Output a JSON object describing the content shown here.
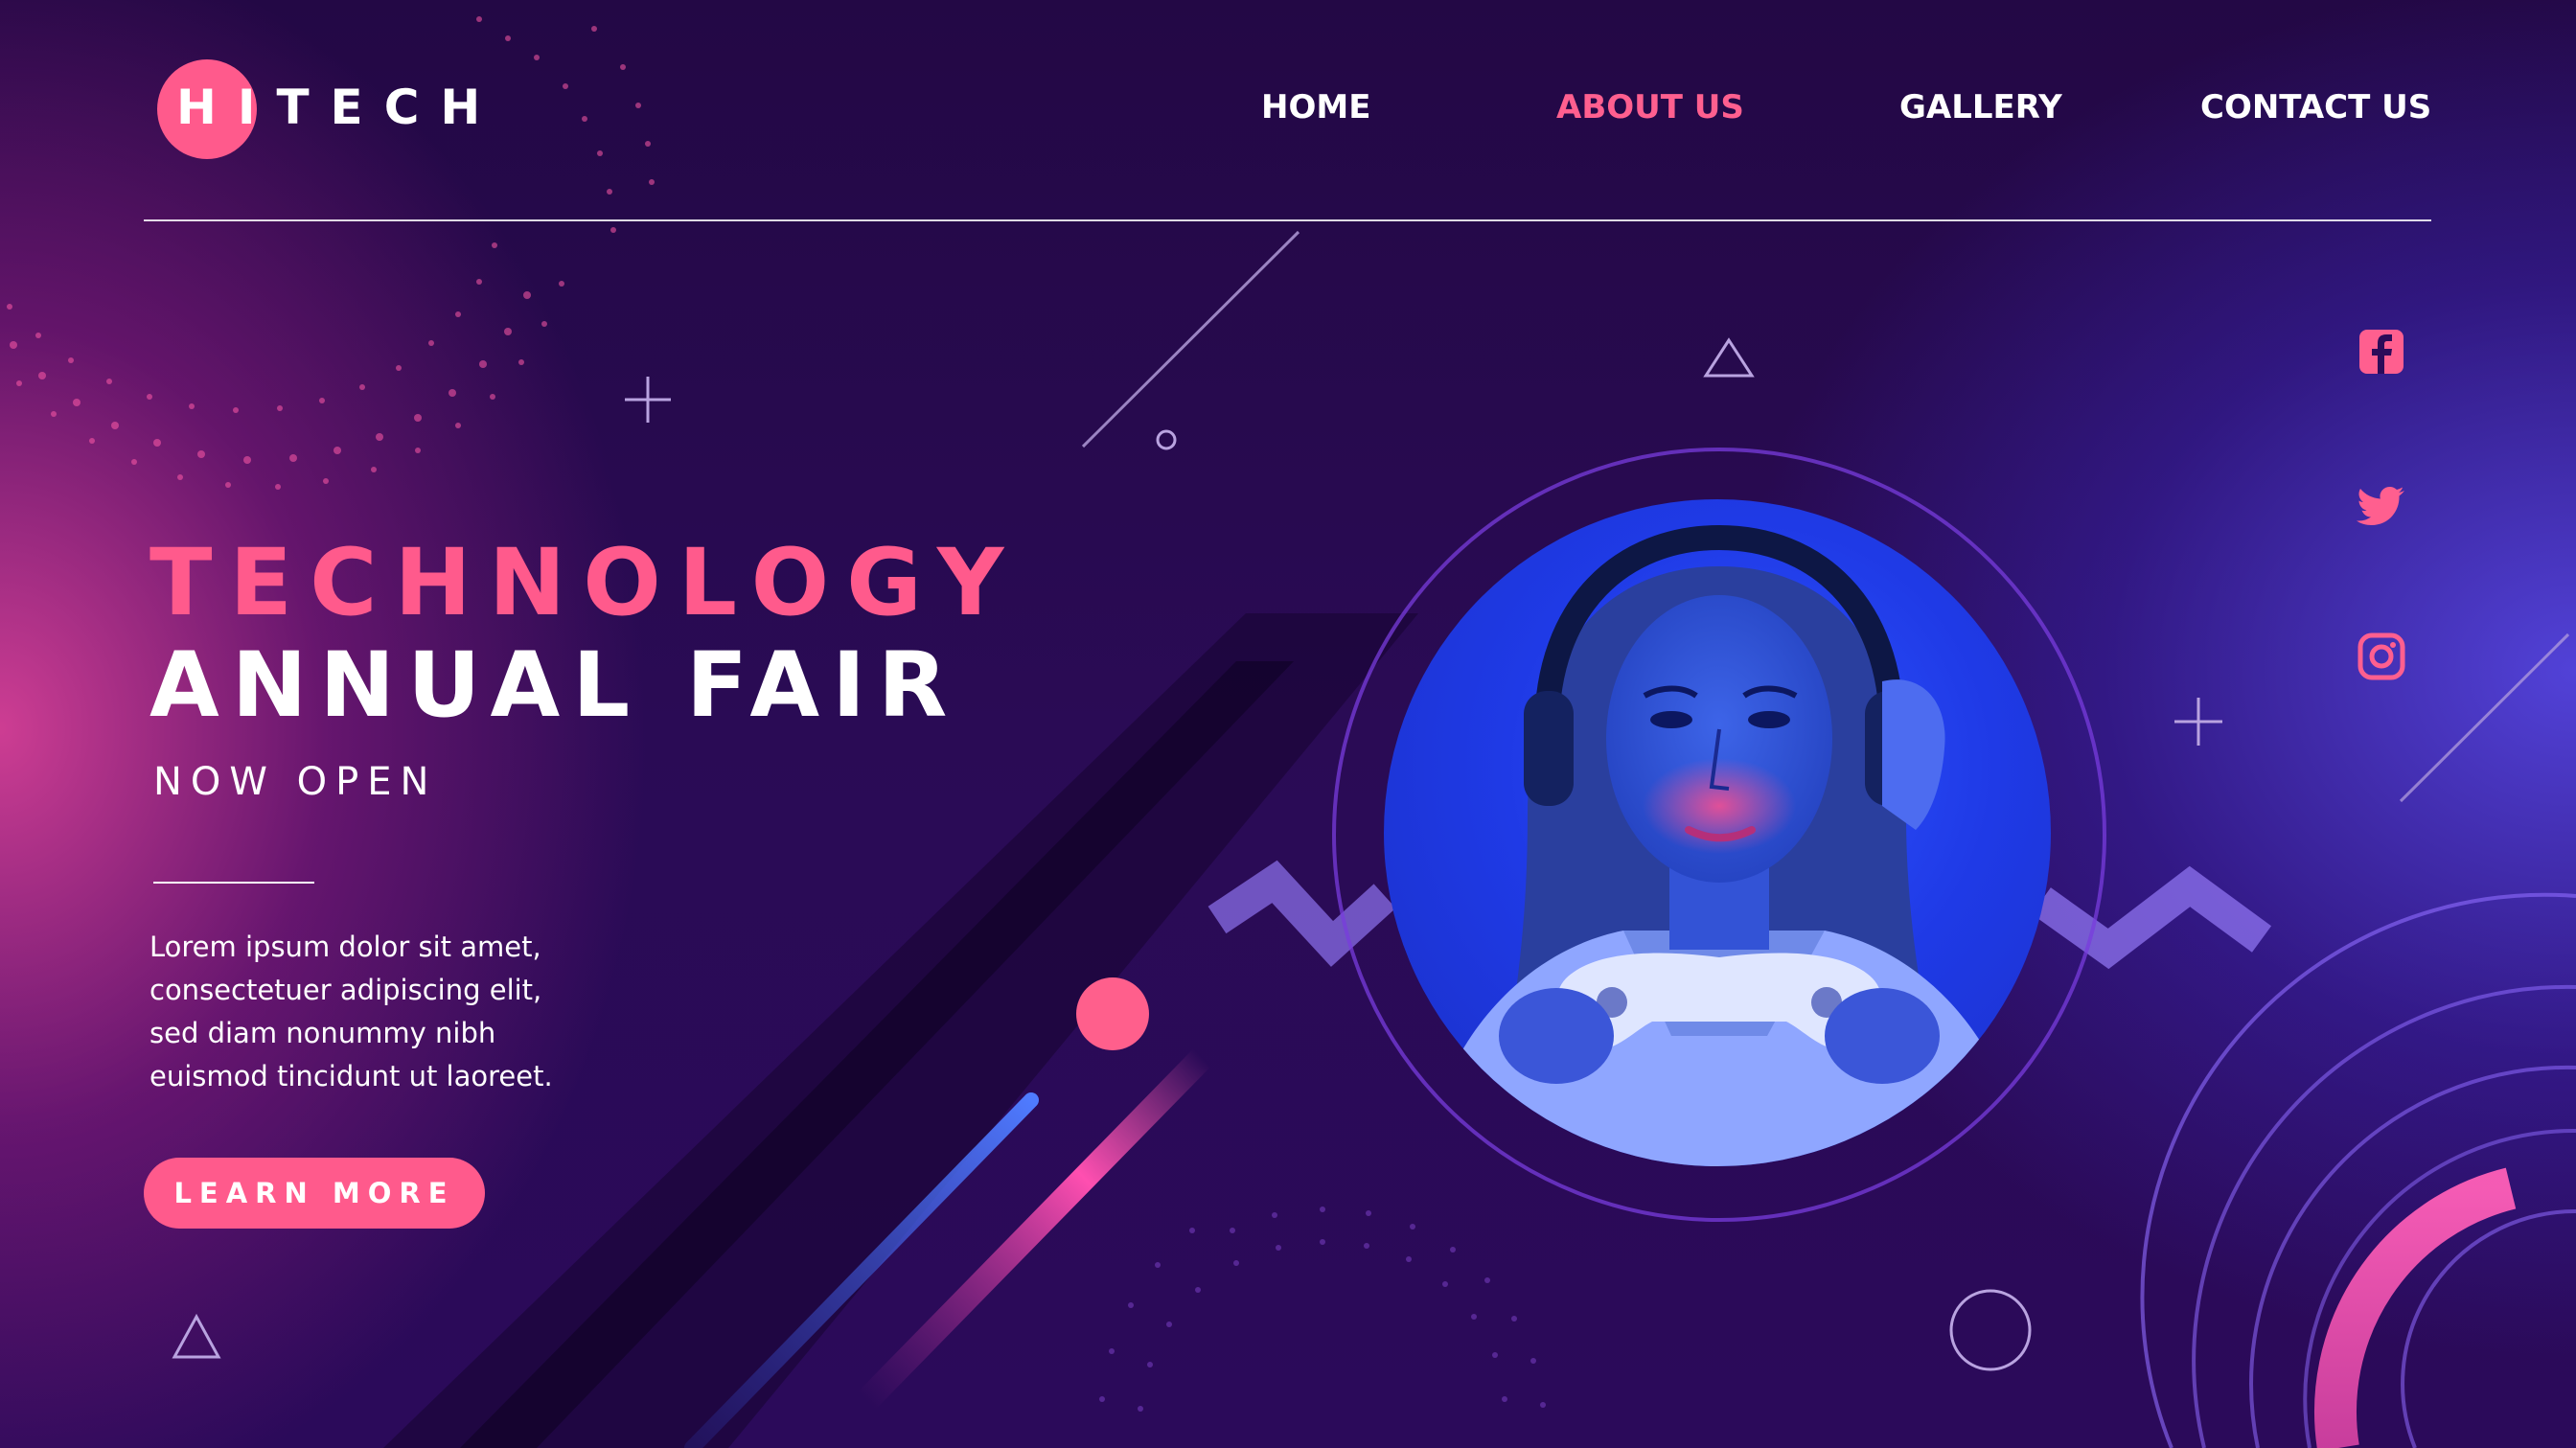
{
  "header": {
    "logo_text": "HITECH",
    "nav": {
      "home": "HOME",
      "about": "ABOUT US",
      "gallery": "GALLERY",
      "contact": "CONTACT US"
    },
    "active_nav": "about"
  },
  "hero": {
    "title_line_1": "TECHNOLOGY",
    "title_line_2": "ANNUAL FAIR",
    "subtitle": "NOW OPEN",
    "body_lines": [
      "Lorem ipsum dolor sit amet,",
      "consectetuer adipiscing elit,",
      "sed diam nonummy nibh",
      "euismod tincidunt ut laoreet."
    ],
    "cta_label": "LEARN MORE"
  },
  "social": {
    "icons": [
      "facebook-icon",
      "twitter-icon",
      "instagram-icon"
    ]
  },
  "colors": {
    "accent": "#ff5a8c",
    "text": "#ffffff",
    "background_dark": "#2a0b55",
    "glow_pink": "#d64096",
    "glow_blue": "#5648e6",
    "photo_blue": "#1f3ae6"
  }
}
